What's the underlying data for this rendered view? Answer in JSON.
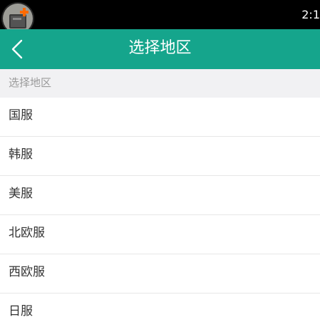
{
  "status_bar": {
    "time": "2:1"
  },
  "header": {
    "title": "选择地区",
    "back_icon": "chevron-left-icon"
  },
  "section": {
    "label": "选择地区"
  },
  "regions": [
    {
      "label": "国服"
    },
    {
      "label": "韩服"
    },
    {
      "label": "美服"
    },
    {
      "label": "北欧服"
    },
    {
      "label": "西欧服"
    },
    {
      "label": "日服"
    }
  ],
  "colors": {
    "accent": "#15a58c",
    "section_bg": "#f1f1f3",
    "status_bg": "#000000"
  }
}
